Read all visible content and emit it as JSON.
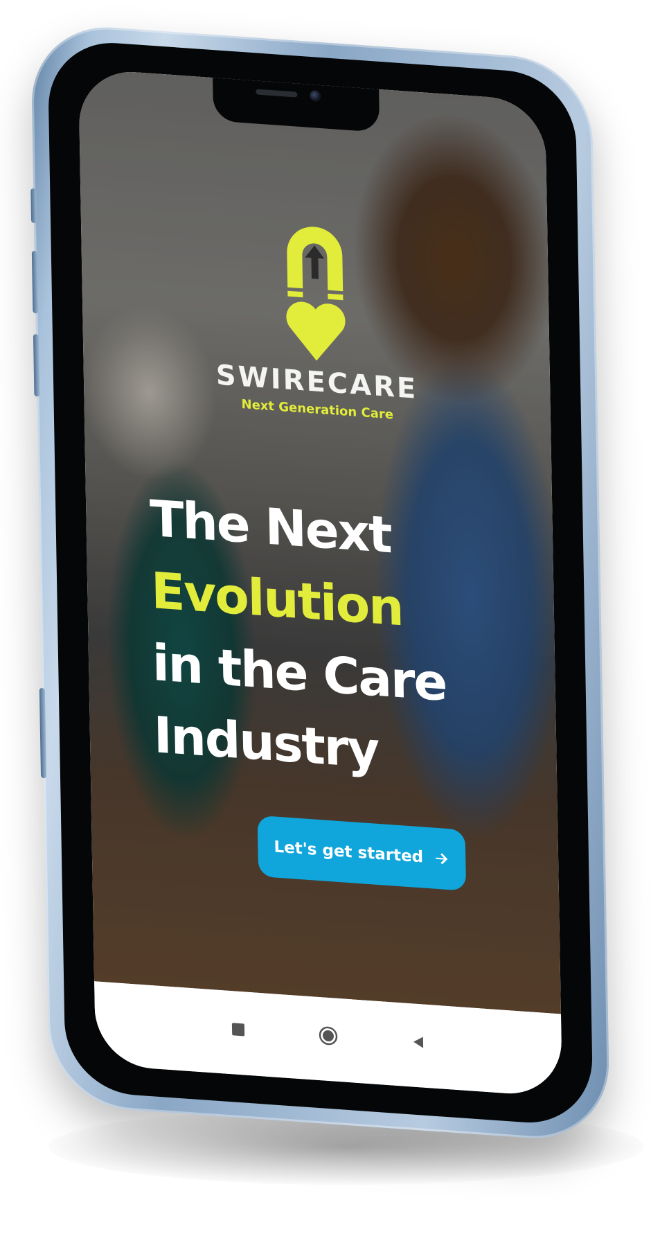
{
  "app": {
    "brand_name": "SWIRECARE",
    "tagline": "Next Generation Care"
  },
  "hero": {
    "line1": "The Next",
    "line2": "Evolution",
    "line3": "in the Care",
    "line4": "Industry"
  },
  "cta": {
    "label": "Let's get started",
    "icon": "arrow-right-icon"
  },
  "nav": {
    "items": [
      {
        "icon": "recents-square-icon"
      },
      {
        "icon": "home-circle-icon"
      },
      {
        "icon": "back-triangle-icon"
      }
    ]
  },
  "colors": {
    "accent_yellow": "#e2ec3a",
    "cta_blue": "#10a6db",
    "frame_blue": "#8aa7c6"
  }
}
